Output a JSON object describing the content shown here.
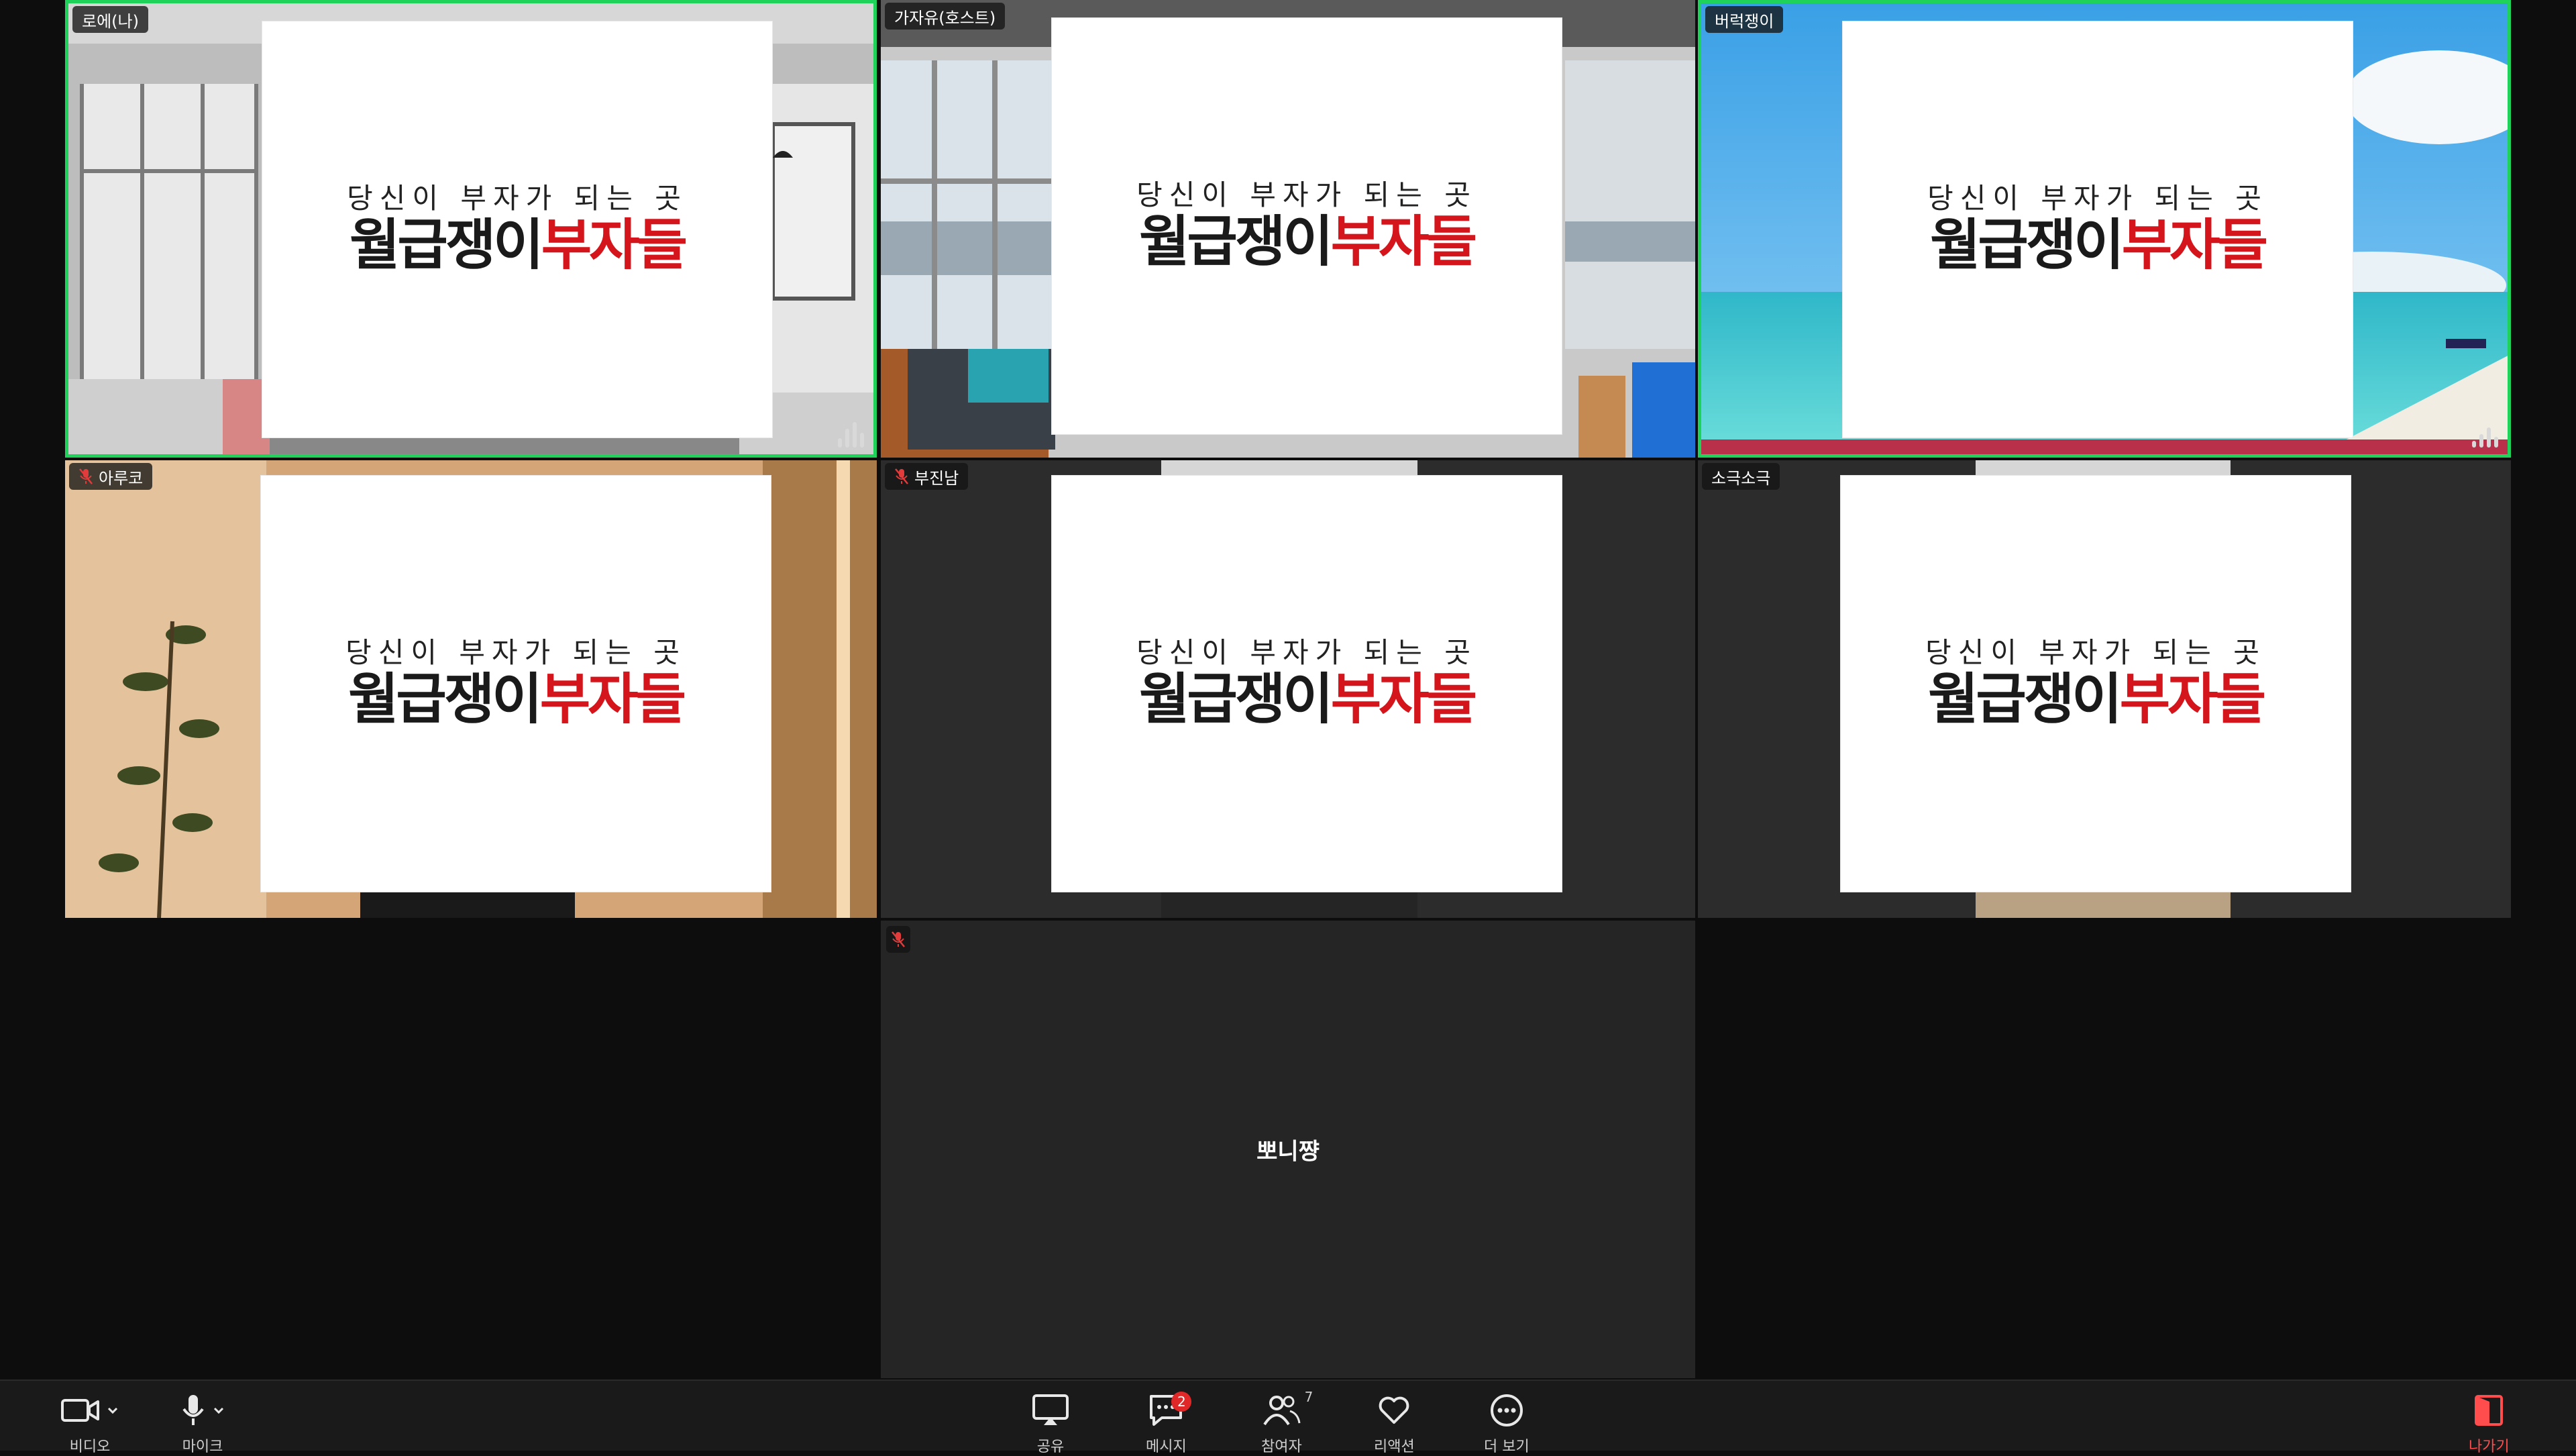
{
  "slide": {
    "subtitle": "당신이 부자가 되는 곳",
    "title_dark": "월급쟁이",
    "title_red": "부자들"
  },
  "participants": [
    {
      "name": "로에(나)",
      "muted": false,
      "active": true
    },
    {
      "name": "가자유(호스트)",
      "muted": false,
      "active": false
    },
    {
      "name": "버럭쟁이",
      "muted": false,
      "active": true
    },
    {
      "name": "아루코",
      "muted": true,
      "active": false
    },
    {
      "name": "부진남",
      "muted": true,
      "active": false
    },
    {
      "name": "소극소극",
      "muted": false,
      "active": false
    },
    {
      "name": "뽀니쨩",
      "muted": true,
      "active": false
    }
  ],
  "toolbar": {
    "video_label": "비디오",
    "mic_label": "마이크",
    "share_label": "공유",
    "chat_label": "메시지",
    "chat_badge": "2",
    "participants_label": "참여자",
    "participants_count": "7",
    "reactions_label": "리액션",
    "more_label": "더 보기",
    "leave_label": "나가기"
  },
  "colors": {
    "active_border": "#1fd35a",
    "slide_red": "#d4161c",
    "leave_red": "#ff4d4d",
    "badge_red": "#e02828"
  }
}
